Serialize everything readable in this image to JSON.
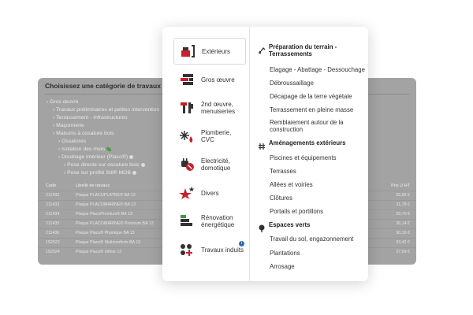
{
  "background": {
    "title": "Choisissez une catégorie de travaux ci-d",
    "tree": [
      {
        "label": "Gros œuvre",
        "level": 1
      },
      {
        "label": "Travaux préliminaires et petites intervention",
        "level": 2
      },
      {
        "label": "Terrassement - Infrastructures",
        "level": 2
      },
      {
        "label": "Maçonnerie",
        "level": 2
      },
      {
        "label": "Maisons à ossature bois",
        "level": 2
      },
      {
        "label": "Ossatures",
        "level": 3
      },
      {
        "label": "Isolation des murs",
        "level": 3
      },
      {
        "label": "Doublage intérieur (Placo®)",
        "level": 3
      },
      {
        "label": "Pose directe sur ossature bois",
        "level": 4
      },
      {
        "label": "Pose sur profilé Stil® MOB",
        "level": 4
      }
    ],
    "table_headers": {
      "code": "Code",
      "libelle": "Libellé de travaux",
      "prix": "Prix U HT"
    },
    "rows": [
      {
        "code": "211432",
        "libelle": "Plaque PLACOPLATRE® BA 13",
        "x": "€",
        "prix": "25,56 €"
      },
      {
        "code": "211433",
        "libelle": "Plaque PLACOMARINE® BA 13",
        "x": "€",
        "prix": "31,78 €"
      },
      {
        "code": "211434",
        "libelle": "Plaque PlacoPremium® BA 13",
        "x": "€",
        "prix": "29,70 €"
      },
      {
        "code": "211435",
        "libelle": "Plaque PLACOMARINE® Premium BA 13",
        "x": "€",
        "prix": "36,14 €"
      },
      {
        "code": "211436",
        "libelle": "Plaque Placo® Phonique BA 13",
        "x": "€",
        "prix": "30,16 €"
      },
      {
        "code": "152522",
        "libelle": "Plaque Placo® Multiconforts BA 13",
        "x": "€",
        "prix": "33,42 €"
      },
      {
        "code": "152524",
        "libelle": "Plaque Placo® Infinie 13",
        "x": "€",
        "prix": "27,69 €"
      }
    ]
  },
  "menu": {
    "categories": [
      {
        "label": "Extérieurs",
        "icon": "exterior-tools-icon",
        "active": true
      },
      {
        "label": "Gros œuvre",
        "icon": "bricks-icon",
        "active": false
      },
      {
        "label": "2nd œuvre, menuiseries",
        "icon": "hammer-icon",
        "active": false
      },
      {
        "label": "Plomberie, CVC",
        "icon": "snowflake-fire-icon",
        "active": false
      },
      {
        "label": "Electricité, domotique",
        "icon": "plug-icon",
        "active": false
      },
      {
        "label": "Divers",
        "icon": "stars-icon",
        "active": false
      },
      {
        "label": "Rénovation énergétique",
        "icon": "energy-bars-icon",
        "active": false
      },
      {
        "label": "Travaux induits",
        "icon": "dots-plus-icon",
        "active": false,
        "badge": "i"
      }
    ],
    "sections": [
      {
        "title": "Préparation du terrain - Terrassements",
        "icon": "excavator-icon",
        "items": [
          "Elagage - Abattage - Dessouchage",
          "Débroussaillage",
          "Décapage de la terre végétale",
          "Terrassement en pleine masse",
          "Remblaiement autour de la construction"
        ]
      },
      {
        "title": "Aménagements extérieurs",
        "icon": "fence-grid-icon",
        "items": [
          "Piscines et équipements",
          "Terrasses",
          "Allées et voiries",
          "Clôtures",
          "Portails et portillons"
        ]
      },
      {
        "title": "Espaces verts",
        "icon": "tree-icon",
        "items": [
          "Travail du sol, engazonnement",
          "Plantations",
          "Arrosage"
        ]
      }
    ]
  },
  "colors": {
    "accent_red": "#c8202e",
    "dark": "#333333",
    "green": "#3a9b44",
    "badge_blue": "#2f6fb5"
  }
}
